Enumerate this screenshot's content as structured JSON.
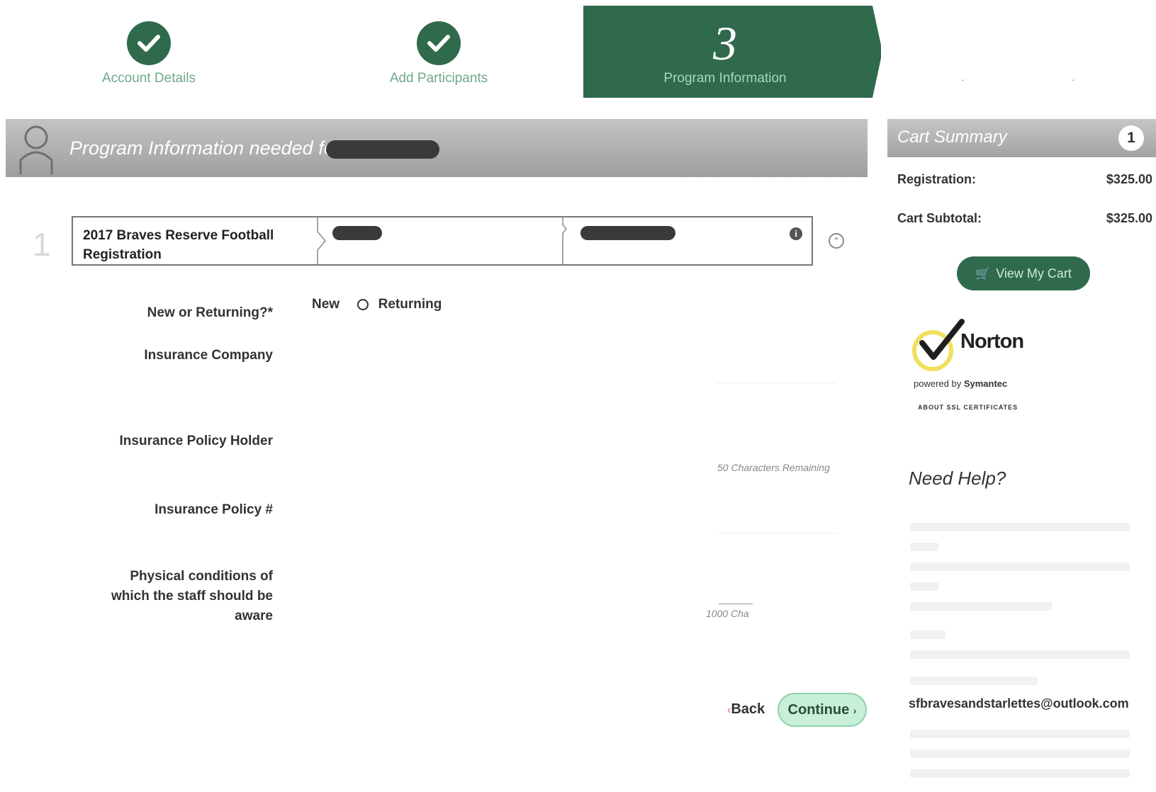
{
  "steps": [
    {
      "label": "Account Details",
      "status": "complete"
    },
    {
      "label": "Add Participants",
      "status": "complete"
    },
    {
      "number": "3",
      "label": "Program Information",
      "status": "active"
    }
  ],
  "program": {
    "title": "Program Information needed for",
    "row_number": "1",
    "registration_name": "2017 Braves Reserve Football Registration"
  },
  "form": {
    "new_or_returning_label": "New or Returning?*",
    "option_new": "New",
    "option_returning": "Returning",
    "selected_option": "Returning",
    "insurance_company_label": "Insurance Company",
    "policy_holder_label": "Insurance Policy Holder",
    "policy_holder_chars": "50 Characters Remaining",
    "policy_number_label": "Insurance Policy #",
    "physical_conditions_label": "Physical conditions of which the staff should be aware",
    "physical_conditions_chars": "1000 Cha"
  },
  "buttons": {
    "back": "Back",
    "continue": "Continue"
  },
  "cart": {
    "title": "Cart Summary",
    "count": "1",
    "registration_label": "Registration:",
    "registration_amount": "$325.00",
    "subtotal_label": "Cart Subtotal:",
    "subtotal_amount": "$325.00",
    "view_cart_label": "View My Cart"
  },
  "norton": {
    "brand": "Norton",
    "powered_prefix": "powered by",
    "powered_company": "Symantec",
    "about": "ABOUT SSL CERTIFICATES"
  },
  "help": {
    "title": "Need Help?",
    "email": "sfbravesandstarlettes@outlook.com"
  },
  "colors": {
    "brand_green": "#2f6a4d",
    "step_label_green": "#6ea98a",
    "continue_bg": "#c8efd8"
  }
}
